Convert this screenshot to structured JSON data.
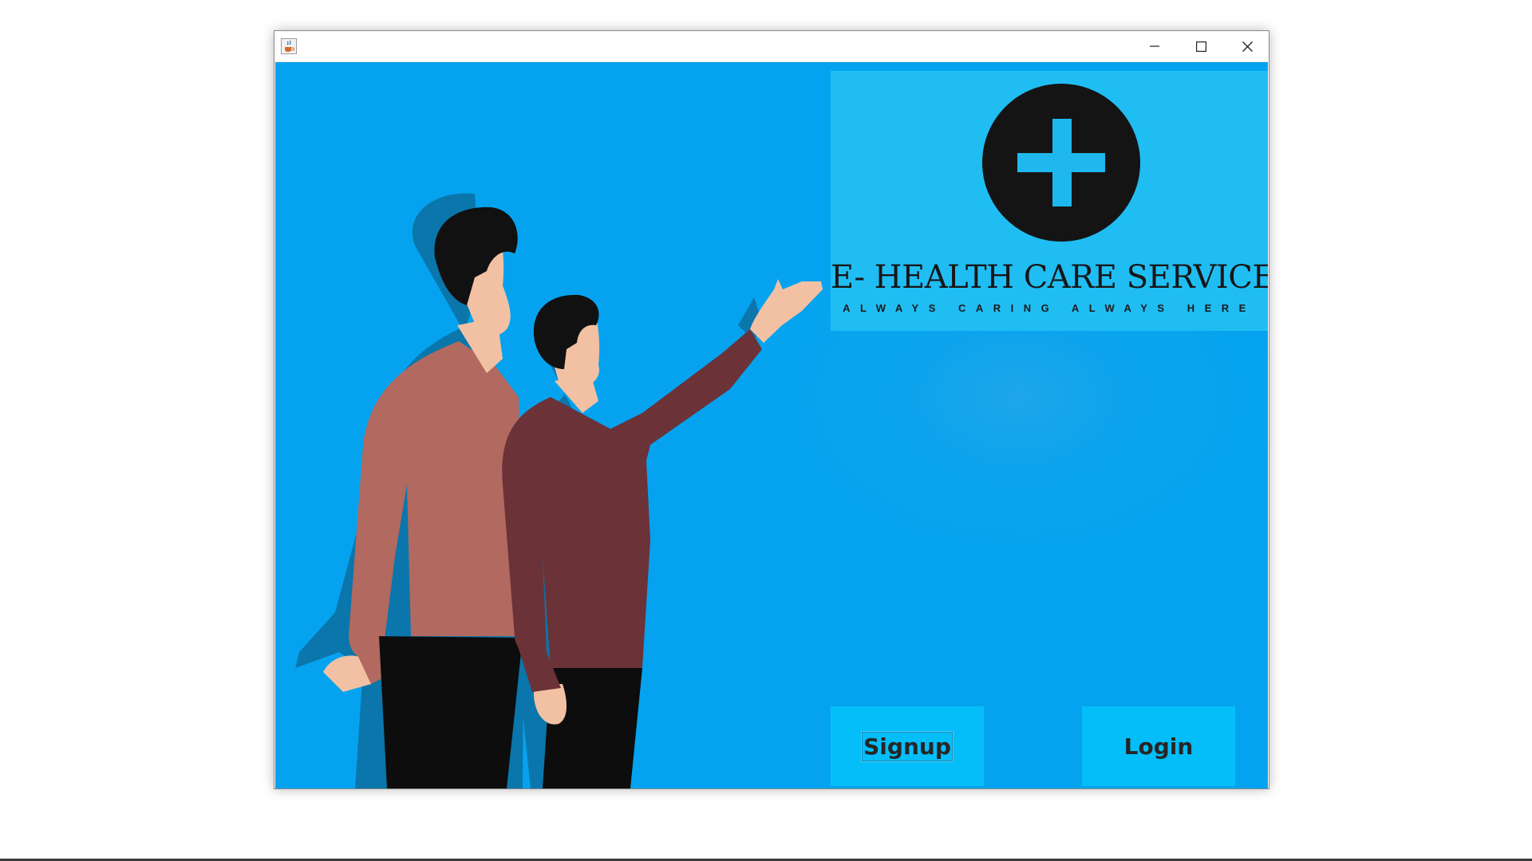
{
  "window": {
    "app_icon": "java-cup-icon",
    "controls": {
      "minimize_icon": "minimize-icon",
      "maximize_icon": "maximize-icon",
      "close_icon": "close-icon"
    }
  },
  "brand": {
    "logo_icon": "medical-cross-icon",
    "title": "E- HEALTH CARE SERVICES",
    "tagline": "ALWAYS CARING ALWAYS HERE"
  },
  "actions": {
    "signup_label": "Signup",
    "login_label": "Login"
  },
  "colors": {
    "background": "#05a3ef",
    "brand_panel": "#20bdf3",
    "button": "#04befa",
    "text_dark": "#171717"
  }
}
